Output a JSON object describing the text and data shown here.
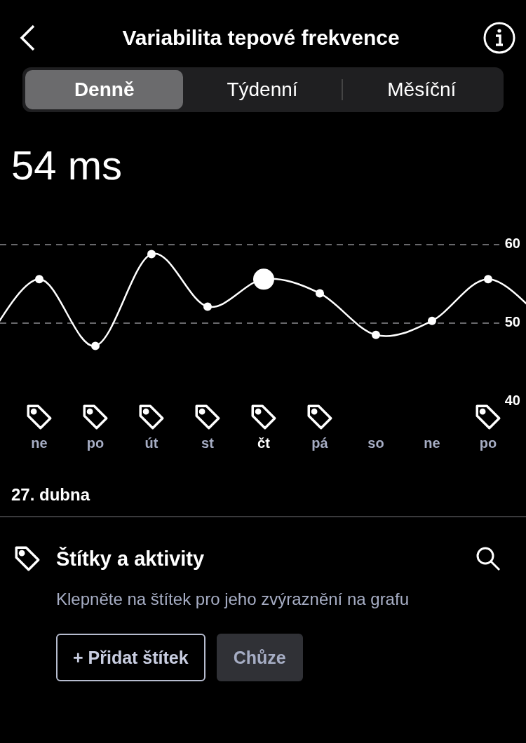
{
  "header": {
    "title": "Variabilita tepové frekvence"
  },
  "tabs": [
    {
      "label": "Denně",
      "selected": true
    },
    {
      "label": "Týdenní",
      "selected": false
    },
    {
      "label": "Měsíční",
      "selected": false
    }
  ],
  "value": "54 ms",
  "chart_data": {
    "type": "line",
    "categories": [
      "ne",
      "po",
      "út",
      "st",
      "čt",
      "pá",
      "so",
      "ne",
      "po"
    ],
    "series": [
      {
        "color": "#ffffff",
        "marker": "circle",
        "values": [
          55.6,
          47.1,
          58.8,
          52.1,
          55.6,
          53.8,
          48.5,
          50.3,
          55.6
        ]
      }
    ],
    "ylim": [
      40,
      60
    ],
    "yticks": [
      40,
      50,
      60
    ]
  },
  "days": [
    {
      "tagged": true,
      "selected": false
    },
    {
      "tagged": true,
      "selected": false
    },
    {
      "tagged": true,
      "selected": false
    },
    {
      "tagged": true,
      "selected": false
    },
    {
      "tagged": true,
      "selected": true
    },
    {
      "tagged": true,
      "selected": false
    },
    {
      "tagged": false,
      "selected": false
    },
    {
      "tagged": false,
      "selected": false
    },
    {
      "tagged": true,
      "selected": false
    }
  ],
  "date": "27. dubna",
  "tags_section": {
    "title": "Štítky a aktivity",
    "description": "Klepněte na štítek pro jeho zvýraznění na grafu",
    "buttons": [
      {
        "kind": "outline",
        "label": "+ Přidat štítek"
      },
      {
        "kind": "filled",
        "label": "Chůze"
      }
    ]
  }
}
